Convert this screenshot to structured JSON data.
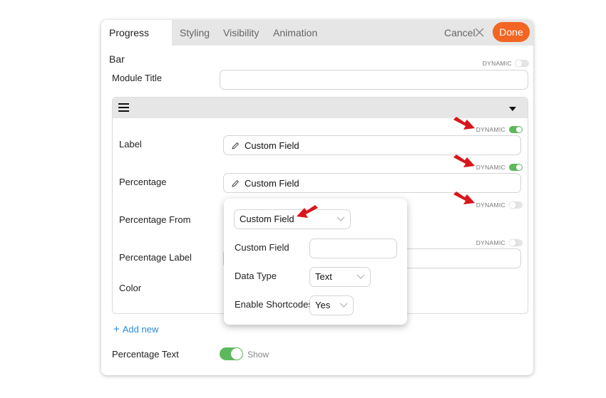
{
  "tabs": [
    {
      "label": "Progress Bar",
      "active": true
    },
    {
      "label": "Styling",
      "active": false
    },
    {
      "label": "Visibility",
      "active": false
    },
    {
      "label": "Animation",
      "active": false
    }
  ],
  "header": {
    "cancel_label": "Cancel",
    "done_label": "Done",
    "done_color": "#f26522"
  },
  "dynamic_label": "DYNAMIC",
  "module_title": {
    "label": "Module Title",
    "value": "",
    "dynamic": false
  },
  "repeater": {
    "rows": [
      {
        "label": "Label",
        "value": "Custom Field",
        "dynamic": true
      },
      {
        "label": "Percentage",
        "value": "Custom Field",
        "dynamic": true
      },
      {
        "label": "Percentage From",
        "dynamic": false
      },
      {
        "label": "Percentage Label",
        "dynamic": false
      },
      {
        "label": "Color"
      }
    ]
  },
  "popup": {
    "source_select": {
      "value": "Custom Field"
    },
    "custom_field": {
      "label": "Custom Field",
      "value": ""
    },
    "data_type": {
      "label": "Data Type",
      "value": "Text"
    },
    "enable_shortcodes": {
      "label": "Enable Shortcodes",
      "value": "Yes"
    }
  },
  "add_new_label": "Add new",
  "percentage_text": {
    "label": "Percentage Text",
    "toggle_on": true,
    "toggle_label": "Show"
  },
  "colors": {
    "toggle_on": "#5cb85c",
    "link": "#2b8bd6",
    "annotation_arrow": "#d9161c"
  }
}
